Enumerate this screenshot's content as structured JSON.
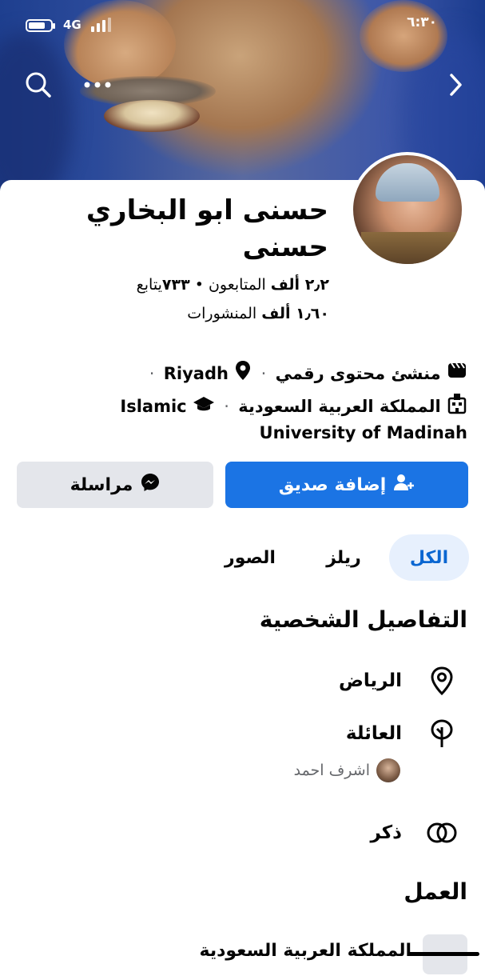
{
  "status_bar": {
    "time": "٦:٣٠",
    "network": "4G"
  },
  "profile": {
    "name_line1": "حسنى ابو البخاري",
    "name_line2": "حسنى",
    "followers_num": "٢٫٢ ",
    "followers_unit": "ألف",
    "followers_label": " المتابعون • ",
    "following_num": "٧٣٣",
    "following_label": "يتابع",
    "posts_num": "١٫٦٠ ",
    "posts_unit": "ألف",
    "posts_label": " المنشورات"
  },
  "meta": {
    "role": "منشئ محتوى رقمي",
    "city": "Riyadh",
    "country": "المملكة العربية السعودية",
    "edu_line1": "Islamic",
    "edu_line2": "University of Madinah"
  },
  "actions": {
    "add_friend": "إضافة صديق",
    "message": "مراسلة"
  },
  "tabs": [
    {
      "label": "الكل",
      "active": true
    },
    {
      "label": "ريلز",
      "active": false
    },
    {
      "label": "الصور",
      "active": false
    }
  ],
  "details": {
    "title": "التفاصيل الشخصية",
    "location": "الرياض",
    "family": "العائلة",
    "relative_name": "اشرف احمد",
    "gender": "ذكر"
  },
  "work": {
    "title": "العمل",
    "first_item": "المملكة العربية السعودية"
  },
  "colors": {
    "primary": "#1b74e4",
    "tab_active_bg": "#e7f0fd",
    "secondary_button": "#e4e6eb"
  }
}
